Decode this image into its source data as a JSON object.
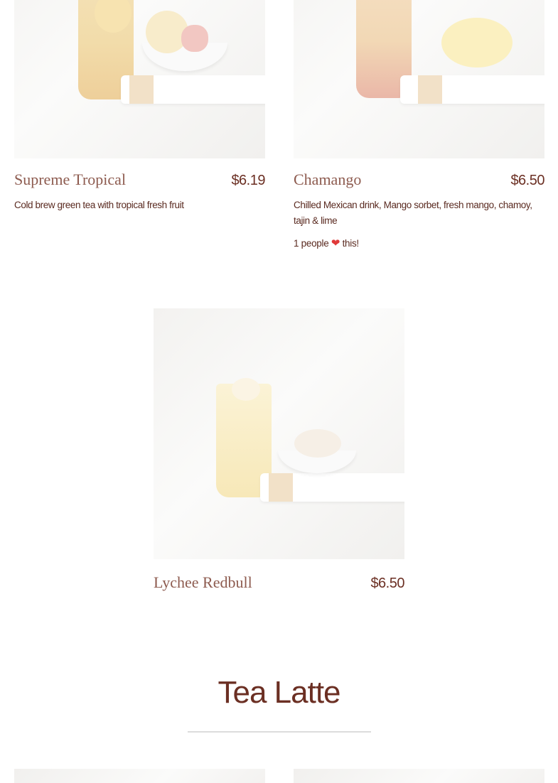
{
  "items": [
    {
      "name": "Supreme Tropical",
      "price": "$6.19",
      "description": "Cold brew green tea with tropical fresh fruit"
    },
    {
      "name": "Chamango",
      "price": "$6.50",
      "description": "Chilled Mexican drink, Mango sorbet, fresh mango, chamoy, tajin & lime",
      "likes_prefix": "1 people",
      "likes_suffix": "this!"
    },
    {
      "name": "Lychee Redbull",
      "price": "$6.50"
    }
  ],
  "section": {
    "title": "Tea Latte"
  },
  "icons": {
    "like": "heart-icon"
  },
  "colors": {
    "text_brown": "#6b2f23",
    "heart": "#e03a3a"
  }
}
